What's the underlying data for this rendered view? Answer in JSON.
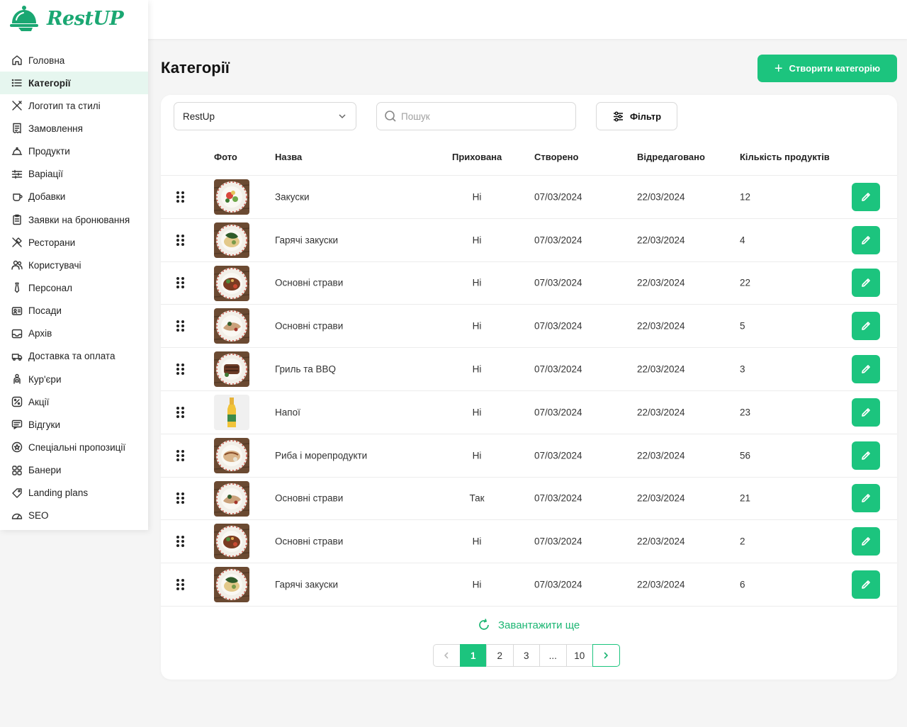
{
  "brand": {
    "name": "RestUP",
    "accent": "#1cc47e"
  },
  "sidebar": {
    "items": [
      {
        "label": "Головна",
        "icon": "home-icon"
      },
      {
        "label": "Категорії",
        "icon": "list-icon",
        "active": true
      },
      {
        "label": "Логотип та стилі",
        "icon": "brush-icon"
      },
      {
        "label": "Замовлення",
        "icon": "receipt-icon"
      },
      {
        "label": "Продукти",
        "icon": "dish-icon"
      },
      {
        "label": "Варіації",
        "icon": "sliders-icon"
      },
      {
        "label": "Добавки",
        "icon": "cup-icon"
      },
      {
        "label": "Заявки на бронювання",
        "icon": "clipboard-icon"
      },
      {
        "label": "Ресторани",
        "icon": "cutlery-icon"
      },
      {
        "label": "Користувачі",
        "icon": "users-icon"
      },
      {
        "label": "Персонал",
        "icon": "tie-icon"
      },
      {
        "label": "Посади",
        "icon": "id-card-icon"
      },
      {
        "label": "Архів",
        "icon": "inbox-icon"
      },
      {
        "label": "Доставка та оплата",
        "icon": "delivery-icon"
      },
      {
        "label": "Кур'єри",
        "icon": "courier-icon"
      },
      {
        "label": "Акції",
        "icon": "percent-icon"
      },
      {
        "label": "Відгуки",
        "icon": "message-icon"
      },
      {
        "label": "Спеціальні пропозиції",
        "icon": "star-icon"
      },
      {
        "label": "Банери",
        "icon": "grid-icon"
      },
      {
        "label": "Landing plans",
        "icon": "tag-icon"
      },
      {
        "label": "SEO",
        "icon": "gauge-icon"
      }
    ]
  },
  "header": {
    "title": "Категорії",
    "create_button": "Створити категорію"
  },
  "toolbar": {
    "restaurant_select": "RestUp",
    "search_placeholder": "Пошук",
    "filter_label": "Фільтр"
  },
  "table": {
    "columns": {
      "photo": "Фото",
      "name": "Назва",
      "hidden": "Прихована",
      "created": "Створено",
      "edited": "Відредаговано",
      "count": "Кількість продуктів"
    },
    "rows": [
      {
        "name": "Закуски",
        "hidden": "Ні",
        "created": "07/03/2024",
        "edited": "22/03/2024",
        "count": "12",
        "photo": "salad"
      },
      {
        "name": "Гарячі закуски",
        "hidden": "Ні",
        "created": "07/03/2024",
        "edited": "22/03/2024",
        "count": "4",
        "photo": "greens"
      },
      {
        "name": "Основні страви",
        "hidden": "Ні",
        "created": "07/03/2024",
        "edited": "22/03/2024",
        "count": "22",
        "photo": "meat"
      },
      {
        "name": "Основні страви",
        "hidden": "Ні",
        "created": "07/03/2024",
        "edited": "22/03/2024",
        "count": "5",
        "photo": "fish"
      },
      {
        "name": "Гриль та BBQ",
        "hidden": "Ні",
        "created": "07/03/2024",
        "edited": "22/03/2024",
        "count": "3",
        "photo": "grill"
      },
      {
        "name": "Напої",
        "hidden": "Ні",
        "created": "07/03/2024",
        "edited": "22/03/2024",
        "count": "23",
        "photo": "bottle"
      },
      {
        "name": "Риба і морепродукти",
        "hidden": "Ні",
        "created": "07/03/2024",
        "edited": "22/03/2024",
        "count": "56",
        "photo": "seafood"
      },
      {
        "name": "Основні страви",
        "hidden": "Так",
        "created": "07/03/2024",
        "edited": "22/03/2024",
        "count": "21",
        "photo": "fish"
      },
      {
        "name": "Основні страви",
        "hidden": "Ні",
        "created": "07/03/2024",
        "edited": "22/03/2024",
        "count": "2",
        "photo": "meat"
      },
      {
        "name": "Гарячі закуски",
        "hidden": "Ні",
        "created": "07/03/2024",
        "edited": "22/03/2024",
        "count": "6",
        "photo": "greens"
      }
    ]
  },
  "load_more": "Завантажити ще",
  "pagination": {
    "pages": [
      "1",
      "2",
      "3",
      "...",
      "10"
    ],
    "current": "1"
  }
}
